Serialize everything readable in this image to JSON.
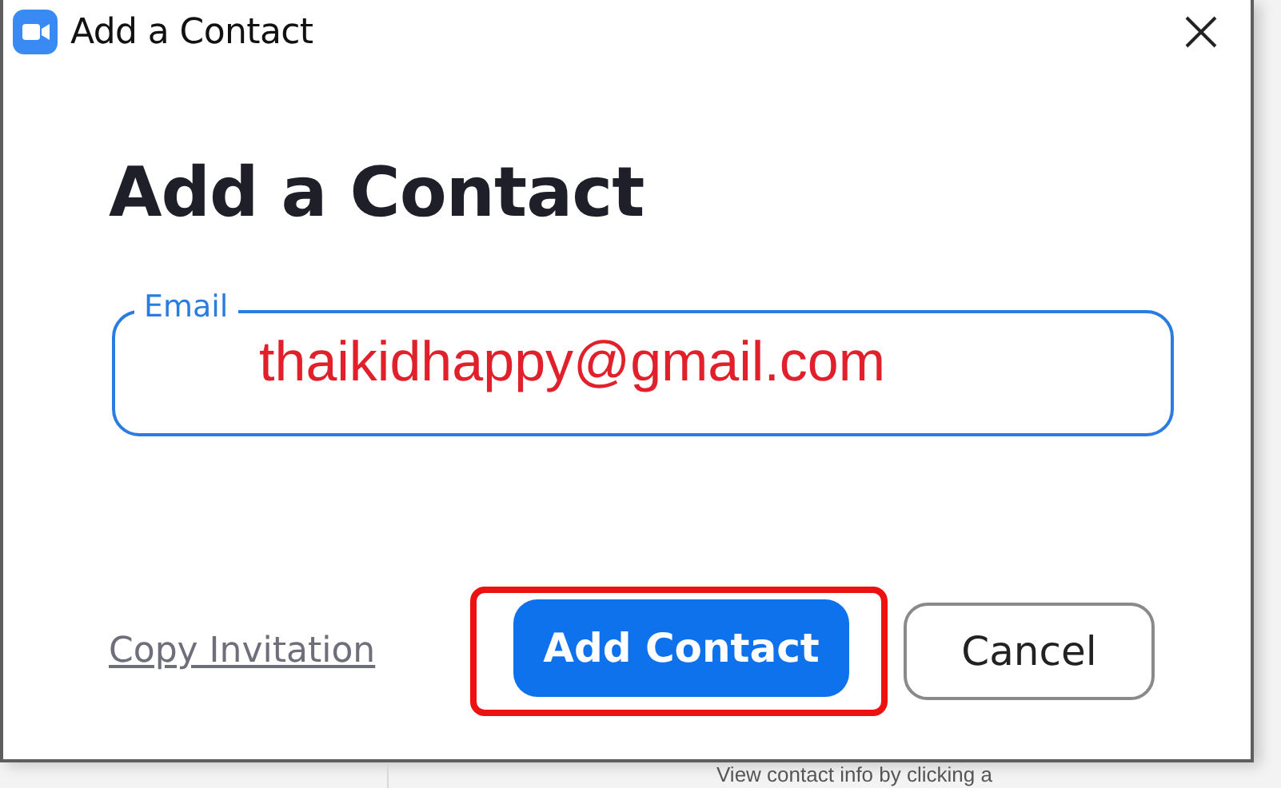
{
  "window": {
    "title": "Add a Contact"
  },
  "heading": "Add a Contact",
  "email_field": {
    "label": "Email",
    "value": "thaikidhappy@gmail.com"
  },
  "link": "Copy Invitation",
  "buttons": [
    {
      "label": "Add Contact",
      "kind": "primary",
      "highlighted": true
    },
    {
      "label": "Cancel",
      "kind": "secondary",
      "highlighted": false
    }
  ],
  "background_text": "View contact info by clicking a"
}
